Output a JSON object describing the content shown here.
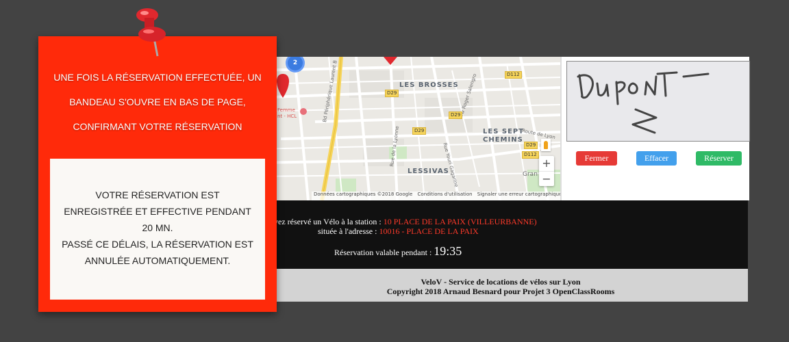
{
  "callout": {
    "lines": [
      "UNE FOIS LA RÉSERVATION EFFECTUÉE, UN",
      "BANDEAU S'OUVRE EN BAS DE PAGE,",
      "CONFIRMANT VOTRE RÉSERVATION"
    ],
    "note_lines": [
      "VOTRE RÉSERVATION EST",
      "ENREGISTRÉE ET EFFECTIVE PENDANT",
      "20 MN.",
      "PASSÉ CE DÉLAIS, LA RÉSERVATION EST",
      "ANNULÉE AUTOMATIQUEMENT."
    ]
  },
  "map": {
    "districts": [
      "LES BROSSES",
      "LES SEPT",
      "CHEMINS",
      "LESSIVAS"
    ],
    "streets": {
      "peripherique": "Bd Périphérique Laurent B",
      "salengro": "Av Roger Salengro",
      "route_lyon": "Route de Lyon",
      "yvonne": "Rue de la Lyonne",
      "gagarine": "Rue Youri Gagarine",
      "hospital_a": "Femme",
      "hospital_b": "nt - HCL",
      "grand": "Gran"
    },
    "roads": [
      "D112",
      "D29",
      "D29",
      "D29",
      "D112",
      "D29"
    ],
    "cluster_count": "2",
    "zoom_in": "+",
    "zoom_out": "−",
    "attribution": [
      "Données cartographiques ©2018 Google",
      "Conditions d'utilisation",
      "Signaler une erreur cartographique"
    ]
  },
  "signature": {
    "buttons": {
      "close": "Fermer",
      "clear": "Effacer",
      "book": "Réserver"
    }
  },
  "banner": {
    "line1_prefix": "vez réservé un Vélo à la station : ",
    "station": "10 PLACE DE LA PAIX (VILLEURBANNE)",
    "line2_prefix": "située à l'adresse : ",
    "address": "10016 - PLACE DE LA PAIX",
    "timer_label": "Réservation valable pendant : ",
    "timer_value": "19:35"
  },
  "footer": {
    "line1": "VeloV - Service de locations de vélos sur Lyon",
    "line2": "Copyright 2018 Arnaud Besnard pour Projet 3 OpenClassRooms"
  },
  "colors": {
    "callout_red": "#ff2a0a",
    "close_button": "#e63a36",
    "clear_button": "#43a0ec",
    "book_button": "#2fba66",
    "banner_red_text": "#ff3a2a"
  }
}
